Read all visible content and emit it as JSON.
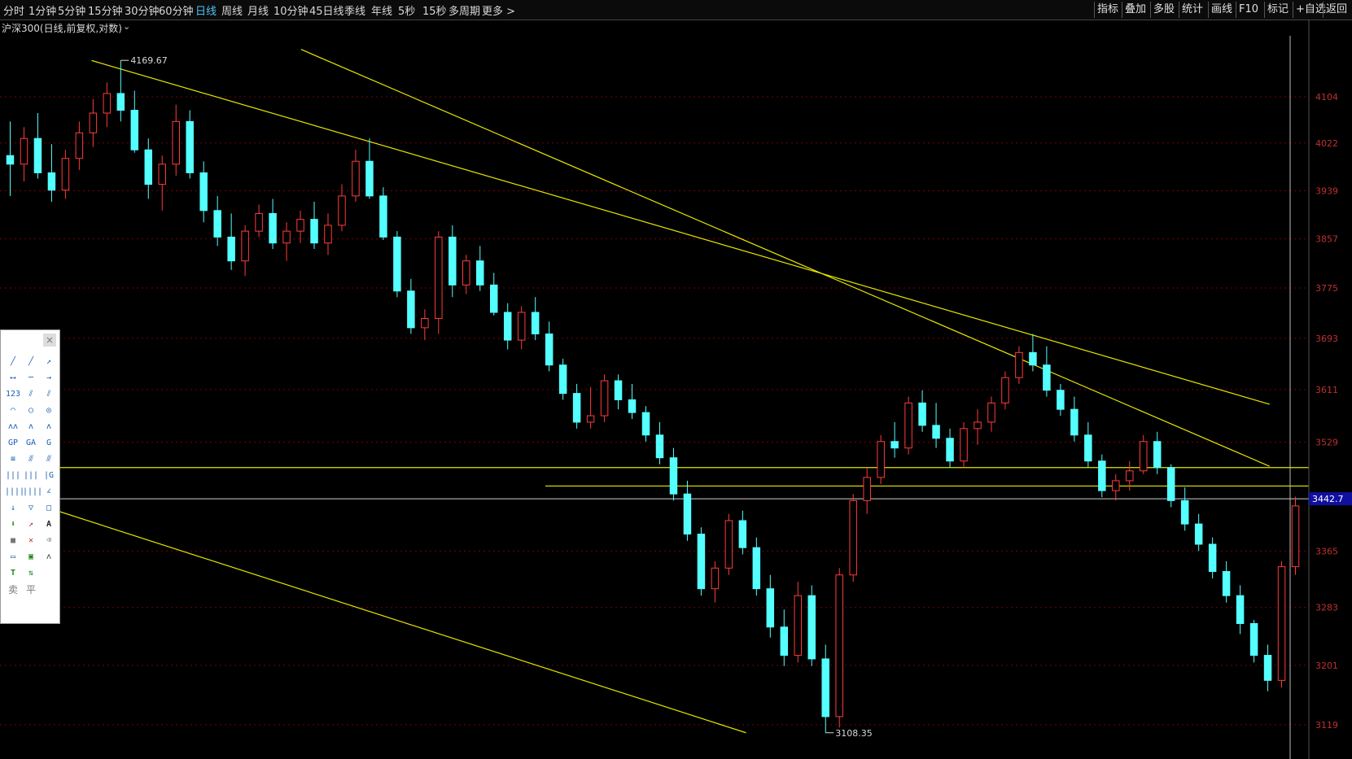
{
  "topbar": {
    "periods": [
      "分时",
      "1分钟",
      "5分钟",
      "15分钟",
      "30分钟",
      "60分钟",
      "日线",
      "周线",
      "月线",
      "10分钟",
      "45日线",
      "季线",
      "年线",
      "5秒",
      "15秒",
      "多周期",
      "更多 >"
    ],
    "active_period": "日线",
    "right_buttons": [
      "指标",
      "叠加",
      "多股",
      "统计",
      "画线",
      "F10",
      "标记",
      "+自选",
      "返回"
    ]
  },
  "chart_header": {
    "title": "沪深300(日线,前复权,对数)",
    "dropdown_icon": "chevron-down-icon"
  },
  "toolbox": {
    "close_icon": "close-icon",
    "sell_label": "卖",
    "flat_label": "平",
    "text_tool_label": "A"
  },
  "colors": {
    "up": "#ff3b3b",
    "down": "#54ffff",
    "trendline": "#e6e600",
    "grid": "#7a0000",
    "axis_text": "#c03030",
    "current": "#1010a0"
  },
  "chart_data": {
    "type": "candlestick",
    "title": "沪深300(日线,前复权,对数)",
    "y_axis": {
      "scale": "log",
      "ticks": [
        4104,
        4022,
        3939,
        3857,
        3775,
        3693,
        3611,
        3529,
        3442.7,
        3365,
        3283,
        3201,
        3119
      ],
      "range": [
        3100,
        4215
      ]
    },
    "annotations": {
      "high": "4169.67",
      "low": "3108.35",
      "current_price": "3442.7"
    },
    "horizontal_lines": [
      3490,
      3462
    ],
    "trendlines": [
      {
        "p1": [
          0.07,
          4169.7
        ],
        "p2": [
          0.97,
          3588
        ]
      },
      {
        "p1": [
          0.23,
          4190
        ],
        "p2": [
          0.97,
          3492
        ]
      },
      {
        "p1": [
          0.04,
          3427
        ],
        "p2": [
          0.57,
          3108
        ]
      }
    ],
    "candles": [
      [
        4000,
        4060,
        3930,
        3985
      ],
      [
        3985,
        4050,
        3955,
        4030
      ],
      [
        4030,
        4075,
        3960,
        3970
      ],
      [
        3970,
        4020,
        3920,
        3940
      ],
      [
        3940,
        4010,
        3925,
        3995
      ],
      [
        3995,
        4060,
        3975,
        4040
      ],
      [
        4040,
        4100,
        4015,
        4075
      ],
      [
        4075,
        4130,
        4050,
        4110
      ],
      [
        4110,
        4170,
        4060,
        4080
      ],
      [
        4080,
        4115,
        4005,
        4010
      ],
      [
        4010,
        4030,
        3925,
        3950
      ],
      [
        3950,
        4000,
        3905,
        3985
      ],
      [
        3985,
        4090,
        3965,
        4060
      ],
      [
        4060,
        4080,
        3960,
        3970
      ],
      [
        3970,
        3990,
        3885,
        3905
      ],
      [
        3905,
        3930,
        3845,
        3860
      ],
      [
        3860,
        3900,
        3805,
        3820
      ],
      [
        3820,
        3880,
        3795,
        3870
      ],
      [
        3870,
        3915,
        3860,
        3900
      ],
      [
        3900,
        3925,
        3840,
        3850
      ],
      [
        3850,
        3885,
        3820,
        3870
      ],
      [
        3870,
        3905,
        3850,
        3890
      ],
      [
        3890,
        3920,
        3840,
        3850
      ],
      [
        3850,
        3900,
        3830,
        3880
      ],
      [
        3880,
        3950,
        3870,
        3930
      ],
      [
        3930,
        4010,
        3920,
        3990
      ],
      [
        3990,
        4030,
        3925,
        3930
      ],
      [
        3930,
        3945,
        3855,
        3860
      ],
      [
        3860,
        3870,
        3760,
        3770
      ],
      [
        3770,
        3790,
        3700,
        3710
      ],
      [
        3710,
        3740,
        3690,
        3725
      ],
      [
        3725,
        3870,
        3700,
        3860
      ],
      [
        3860,
        3880,
        3760,
        3780
      ],
      [
        3780,
        3830,
        3765,
        3820
      ],
      [
        3820,
        3845,
        3770,
        3780
      ],
      [
        3780,
        3800,
        3730,
        3735
      ],
      [
        3735,
        3750,
        3675,
        3690
      ],
      [
        3690,
        3745,
        3675,
        3735
      ],
      [
        3735,
        3760,
        3690,
        3700
      ],
      [
        3700,
        3720,
        3640,
        3650
      ],
      [
        3650,
        3660,
        3595,
        3605
      ],
      [
        3605,
        3620,
        3550,
        3560
      ],
      [
        3560,
        3615,
        3550,
        3570
      ],
      [
        3570,
        3635,
        3560,
        3625
      ],
      [
        3625,
        3635,
        3580,
        3595
      ],
      [
        3595,
        3620,
        3565,
        3575
      ],
      [
        3575,
        3585,
        3530,
        3540
      ],
      [
        3540,
        3560,
        3495,
        3505
      ],
      [
        3505,
        3520,
        3440,
        3450
      ],
      [
        3450,
        3470,
        3380,
        3390
      ],
      [
        3390,
        3400,
        3300,
        3310
      ],
      [
        3310,
        3350,
        3290,
        3340
      ],
      [
        3340,
        3420,
        3330,
        3410
      ],
      [
        3410,
        3425,
        3360,
        3370
      ],
      [
        3370,
        3385,
        3300,
        3310
      ],
      [
        3310,
        3330,
        3240,
        3255
      ],
      [
        3255,
        3280,
        3200,
        3215
      ],
      [
        3215,
        3320,
        3205,
        3300
      ],
      [
        3300,
        3315,
        3200,
        3210
      ],
      [
        3210,
        3230,
        3108,
        3130
      ],
      [
        3130,
        3340,
        3115,
        3330
      ],
      [
        3330,
        3450,
        3320,
        3440
      ],
      [
        3440,
        3490,
        3420,
        3475
      ],
      [
        3475,
        3540,
        3465,
        3530
      ],
      [
        3530,
        3560,
        3505,
        3520
      ],
      [
        3520,
        3600,
        3510,
        3590
      ],
      [
        3590,
        3610,
        3545,
        3555
      ],
      [
        3555,
        3590,
        3520,
        3535
      ],
      [
        3535,
        3550,
        3490,
        3500
      ],
      [
        3500,
        3560,
        3490,
        3550
      ],
      [
        3550,
        3580,
        3525,
        3560
      ],
      [
        3560,
        3600,
        3545,
        3590
      ],
      [
        3590,
        3640,
        3580,
        3630
      ],
      [
        3630,
        3680,
        3620,
        3670
      ],
      [
        3670,
        3700,
        3640,
        3650
      ],
      [
        3650,
        3680,
        3600,
        3610
      ],
      [
        3610,
        3620,
        3570,
        3580
      ],
      [
        3580,
        3600,
        3530,
        3540
      ],
      [
        3540,
        3560,
        3490,
        3500
      ],
      [
        3500,
        3510,
        3445,
        3455
      ],
      [
        3455,
        3480,
        3440,
        3470
      ],
      [
        3470,
        3500,
        3455,
        3485
      ],
      [
        3485,
        3540,
        3480,
        3530
      ],
      [
        3530,
        3545,
        3480,
        3490
      ],
      [
        3490,
        3495,
        3430,
        3440
      ],
      [
        3440,
        3460,
        3395,
        3405
      ],
      [
        3405,
        3420,
        3365,
        3375
      ],
      [
        3375,
        3385,
        3325,
        3335
      ],
      [
        3335,
        3350,
        3290,
        3300
      ],
      [
        3300,
        3315,
        3245,
        3260
      ],
      [
        3260,
        3265,
        3205,
        3215
      ],
      [
        3215,
        3230,
        3165,
        3180
      ],
      [
        3180,
        3350,
        3170,
        3342
      ],
      [
        3342,
        3446,
        3330,
        3432
      ]
    ]
  }
}
